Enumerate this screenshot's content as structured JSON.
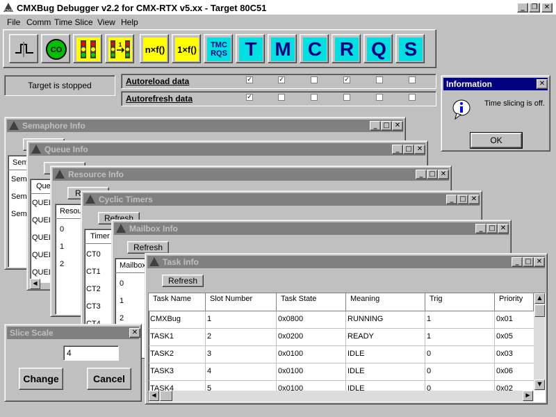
{
  "app": {
    "title": "CMXBug Debugger v2.2 for CMX-RTX v5.xx - Target 80C51"
  },
  "menu": [
    {
      "label": "File"
    },
    {
      "label": "Comm"
    },
    {
      "label": "Time Slice"
    },
    {
      "label": "View"
    },
    {
      "label": "Help"
    }
  ],
  "toolbar": {
    "icon_names": [
      "step-icon",
      "co-icon",
      "traffic-light-icon",
      "single-step-icon",
      "n-times-f-icon",
      "one-times-f-icon",
      "tmc-rqs-icon"
    ],
    "nxf_label": "n×f()",
    "onexf_label": "1×f()",
    "tmc_label": "TMC",
    "rqs_label": "RQS",
    "letters": [
      "T",
      "M",
      "C",
      "R",
      "Q",
      "S"
    ],
    "accent_color": "#00e0e0",
    "yellow_color": "#ffff00"
  },
  "status": {
    "text": "Target is stopped"
  },
  "autoreload": {
    "label": "Autoreload data",
    "checks": [
      true,
      true,
      false,
      true,
      false,
      false
    ]
  },
  "autorefresh": {
    "label": "Autorefresh data",
    "checks": [
      true,
      false,
      false,
      false,
      false,
      false
    ]
  },
  "info_dialog": {
    "title": "Information",
    "message": "Time slicing is off.",
    "ok": "OK"
  },
  "semaphore": {
    "title": "Semaphore Info",
    "header": "Sem",
    "rows": [
      "Sema",
      "Sema",
      "Sema"
    ]
  },
  "queue": {
    "title": "Queue Info",
    "header": "Que",
    "rows": [
      "QUEL",
      "QUEL",
      "QUEL",
      "QUEL",
      "QUEL"
    ]
  },
  "resource": {
    "title": "Resource Info",
    "refresh": "R",
    "header": "Resou",
    "rows": [
      "0",
      "1",
      "2"
    ]
  },
  "cyclic": {
    "title": "Cyclic Timers",
    "refresh": "Refresh",
    "header": "Timer",
    "rows": [
      "CT0",
      "CT1",
      "CT2",
      "CT3",
      "CT4"
    ]
  },
  "mailbox": {
    "title": "Mailbox Info",
    "refresh": "Refresh",
    "header": "Mailbox",
    "rows": [
      "0",
      "1",
      "2"
    ]
  },
  "task": {
    "title": "Task Info",
    "refresh": "Refresh",
    "columns": [
      "Task Name",
      "Slot Number",
      "Task State",
      "Meaning",
      "Trig",
      "Priority"
    ],
    "rows": [
      [
        "CMXBug",
        "1",
        "0x0800",
        "RUNNING",
        "1",
        "0x01"
      ],
      [
        "TASK1",
        "2",
        "0x0200",
        "READY",
        "1",
        "0x05"
      ],
      [
        "TASK2",
        "3",
        "0x0100",
        "IDLE",
        "0",
        "0x03"
      ],
      [
        "TASK3",
        "4",
        "0x0100",
        "IDLE",
        "0",
        "0x06"
      ],
      [
        "TASK4",
        "5",
        "0x0100",
        "IDLE",
        "0",
        "0x02"
      ]
    ]
  },
  "slice": {
    "title": "Slice Scale",
    "value": "4",
    "change": "Change",
    "cancel": "Cancel"
  }
}
